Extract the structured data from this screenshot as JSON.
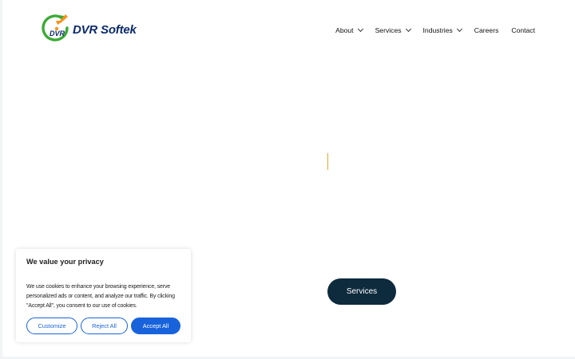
{
  "brand": {
    "name": "DVR Softek",
    "logo_letters": "DVR",
    "color": "#0b2a6b",
    "accent_orange": "#f7931e",
    "accent_green": "#3aaa35"
  },
  "nav": {
    "items": [
      {
        "label": "About",
        "has_dropdown": true
      },
      {
        "label": "Services",
        "has_dropdown": true
      },
      {
        "label": "Industries",
        "has_dropdown": true
      },
      {
        "label": "Careers",
        "has_dropdown": false
      },
      {
        "label": "Contact",
        "has_dropdown": false
      }
    ]
  },
  "hero": {
    "button_label": "Services",
    "button_color": "#0e2a3d"
  },
  "cookie_banner": {
    "title": "We value your privacy",
    "body": "We use cookies to enhance your browsing experience, serve personalized ads or content, and analyze our traffic. By clicking \"Accept All\", you consent to our use of cookies.",
    "buttons": {
      "customize": "Customize",
      "reject": "Reject All",
      "accept": "Accept All"
    },
    "accent_color": "#1863dc"
  },
  "icons": {
    "dropdown": "chevron-down-icon"
  }
}
